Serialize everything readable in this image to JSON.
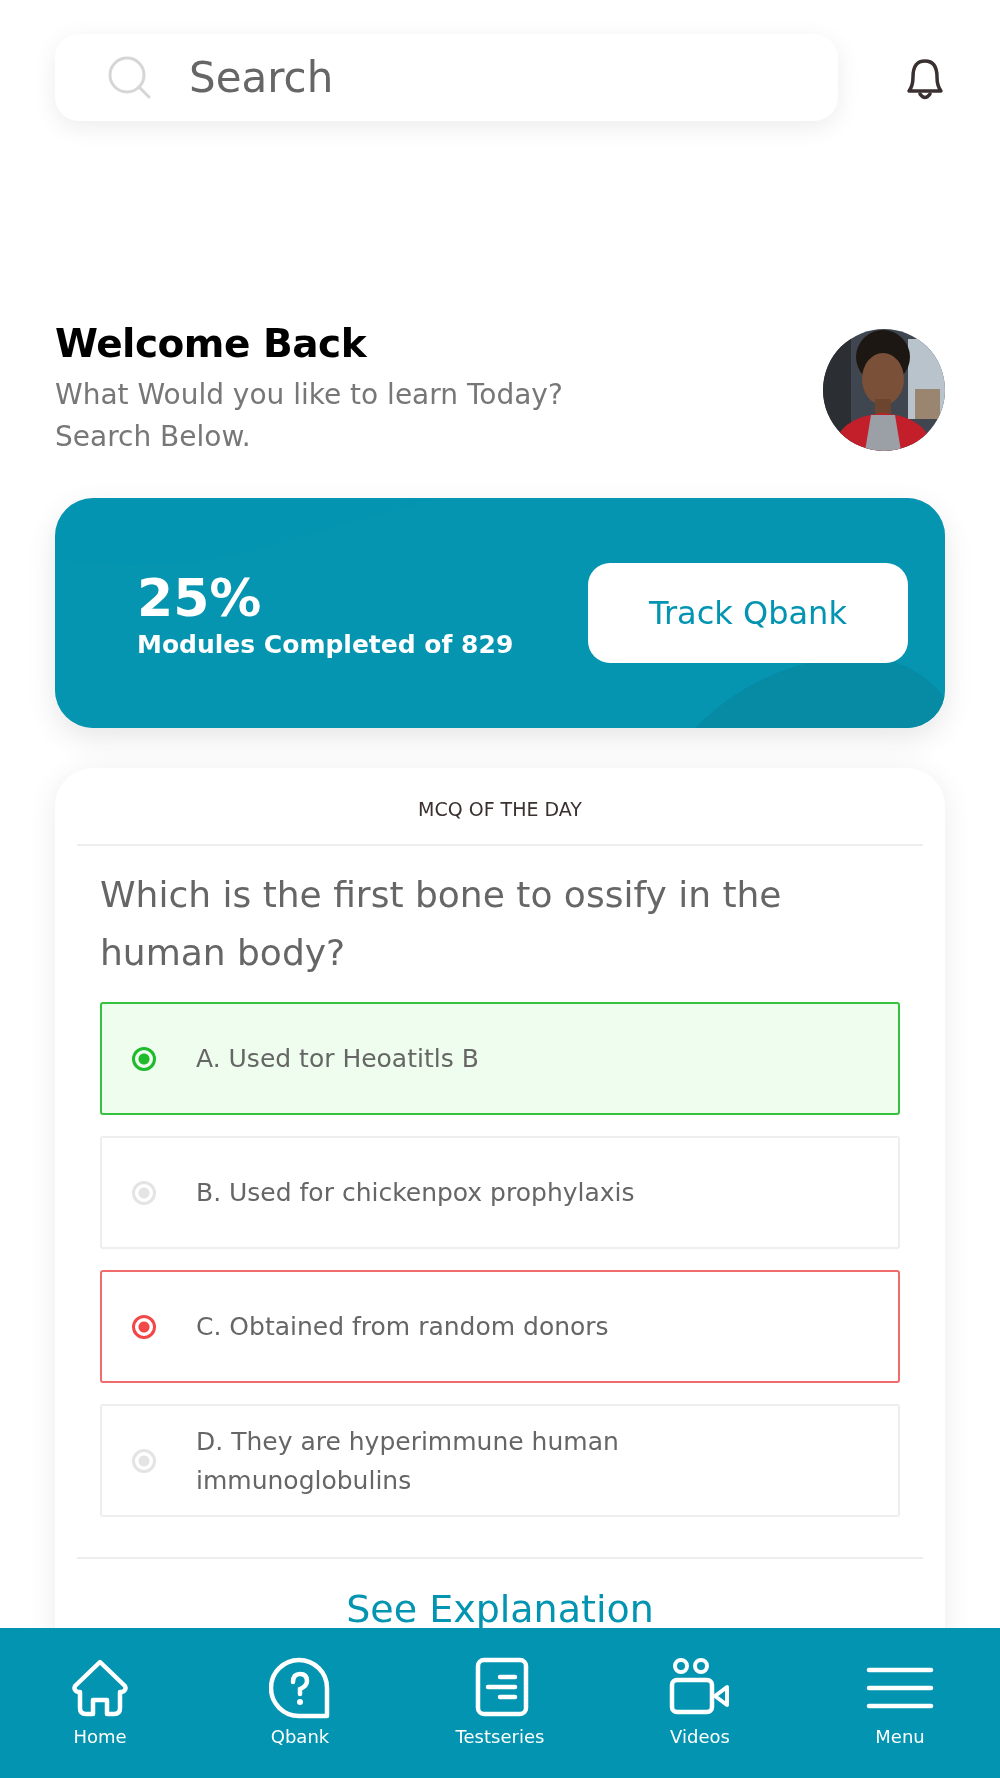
{
  "search": {
    "placeholder": "Search"
  },
  "greeting": {
    "title": "Welcome Back",
    "subtitle": "What Would you like to learn Today?\nSearch Below."
  },
  "progress_card": {
    "percent": "25%",
    "caption": "Modules Completed of 829",
    "button": "Track Qbank"
  },
  "mcq": {
    "heading": "MCQ OF THE DAY",
    "question": "Which is the first bone to ossify in the human body?",
    "options": [
      {
        "text": "A. Used tor Heoatitls B",
        "selected": true,
        "correct": true
      },
      {
        "text": "B. Used for chickenpox prophylaxis",
        "selected": false,
        "correct": false
      },
      {
        "text": "C. Obtained from random donors",
        "selected": true,
        "correct": false
      },
      {
        "text": "D. They are hyperimmune human immunoglobulins",
        "selected": false,
        "correct": false
      }
    ],
    "link": "See Explanation"
  },
  "bottom_nav": [
    {
      "label": "Home",
      "kind": "home"
    },
    {
      "label": "Qbank",
      "kind": "question"
    },
    {
      "label": "Testseries",
      "kind": "list"
    },
    {
      "label": "Videos",
      "kind": "video"
    },
    {
      "label": "Menu",
      "kind": "menu"
    }
  ]
}
